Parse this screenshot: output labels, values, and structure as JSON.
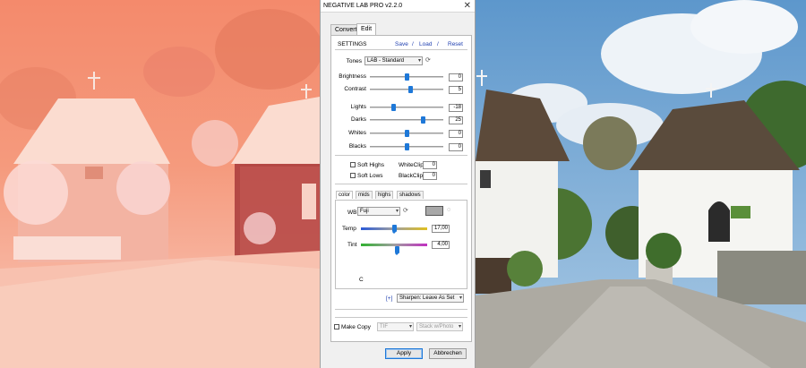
{
  "window": {
    "title": "NEGATIVE LAB PRO v2.2.0",
    "close_glyph": "✕"
  },
  "tabs": [
    {
      "label": "Convert"
    },
    {
      "label": "Edit",
      "active": true
    }
  ],
  "settings": {
    "label": "SETTINGS",
    "save": "Save",
    "load": "Load",
    "reset": "Reset",
    "sep1": "/",
    "sep2": "/"
  },
  "tones": {
    "label": "Tones",
    "value": "LAB - Standard"
  },
  "sliders": [
    {
      "label": "Brightness",
      "value": "0",
      "level": 0.5
    },
    {
      "label": "Contrast",
      "value": "5",
      "level": 0.55
    },
    {
      "label": "Lights",
      "value": "-18",
      "level": 0.32
    },
    {
      "label": "Darks",
      "value": "25",
      "level": 0.72
    },
    {
      "label": "Whites",
      "value": "0",
      "level": 0.5
    },
    {
      "label": "Blacks",
      "value": "0",
      "level": 0.5
    }
  ],
  "clipping": {
    "soft_highs": "Soft Highs",
    "soft_lows": "Soft Lows",
    "whiteclip_label": "WhiteClip",
    "whiteclip_value": "0",
    "blackclip_label": "BlackClip",
    "blackclip_value": "0"
  },
  "color_tabs": [
    {
      "label": "color",
      "active": true
    },
    {
      "label": "mids"
    },
    {
      "label": "highs"
    },
    {
      "label": "shadows"
    }
  ],
  "color": {
    "wb_label": "WB",
    "wb_value": "Fuji",
    "temp_label": "Temp",
    "temp_value": "17,00",
    "temp_level": 0.5,
    "tint_label": "Tint",
    "tint_value": "4,00",
    "tint_level": 0.55,
    "c_label": "C"
  },
  "sharpen": {
    "plus": "[+]",
    "value": "Sharpen: Leave As Set"
  },
  "copy": {
    "label": "Make Copy",
    "format": "TIF",
    "stack": "Stack w/Photo"
  },
  "buttons": {
    "apply": "Apply",
    "cancel": "Abbrechen"
  },
  "colors": {
    "accent": "#1e78d8",
    "link": "#1f3fb0",
    "negative_tint": "#f48a6c",
    "sky": "#7fb0d8"
  }
}
